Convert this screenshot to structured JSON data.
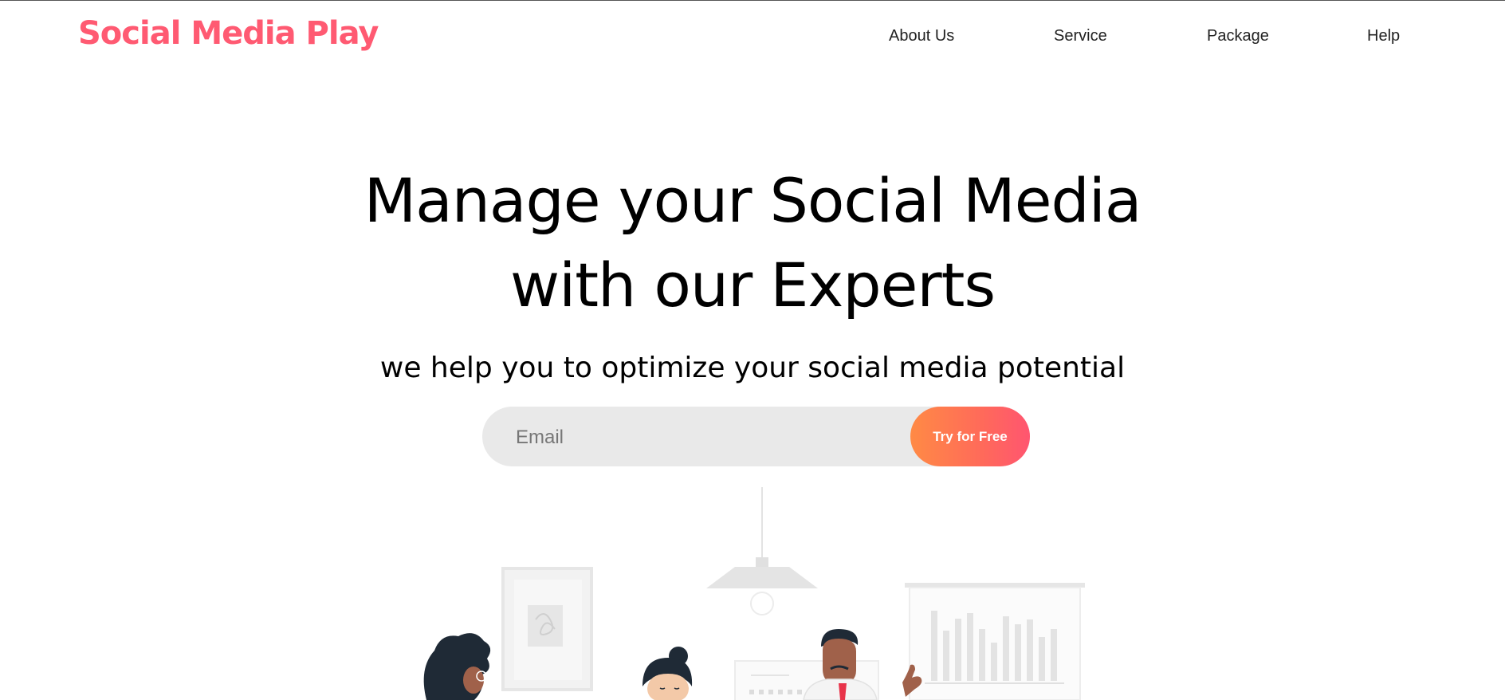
{
  "brand": {
    "name": "Social Media Play",
    "color": "#ff5a72"
  },
  "nav": {
    "items": [
      {
        "label": "About Us"
      },
      {
        "label": "Service"
      },
      {
        "label": "Package"
      },
      {
        "label": "Help"
      }
    ]
  },
  "hero": {
    "title_line1": "Manage your Social Media",
    "title_line2": "with our Experts",
    "subtitle": "we help you to optimize your social media potential"
  },
  "signup": {
    "email_placeholder": "Email",
    "email_value": "",
    "button_label": "Try for Free",
    "button_gradient": [
      "#ff8a45",
      "#ff5570"
    ]
  },
  "illustration": {
    "icon": "team-meeting-illustration",
    "skin_tone": "#a0614a",
    "hair_color": "#1f2a36",
    "tie_color": "#e8334a"
  }
}
